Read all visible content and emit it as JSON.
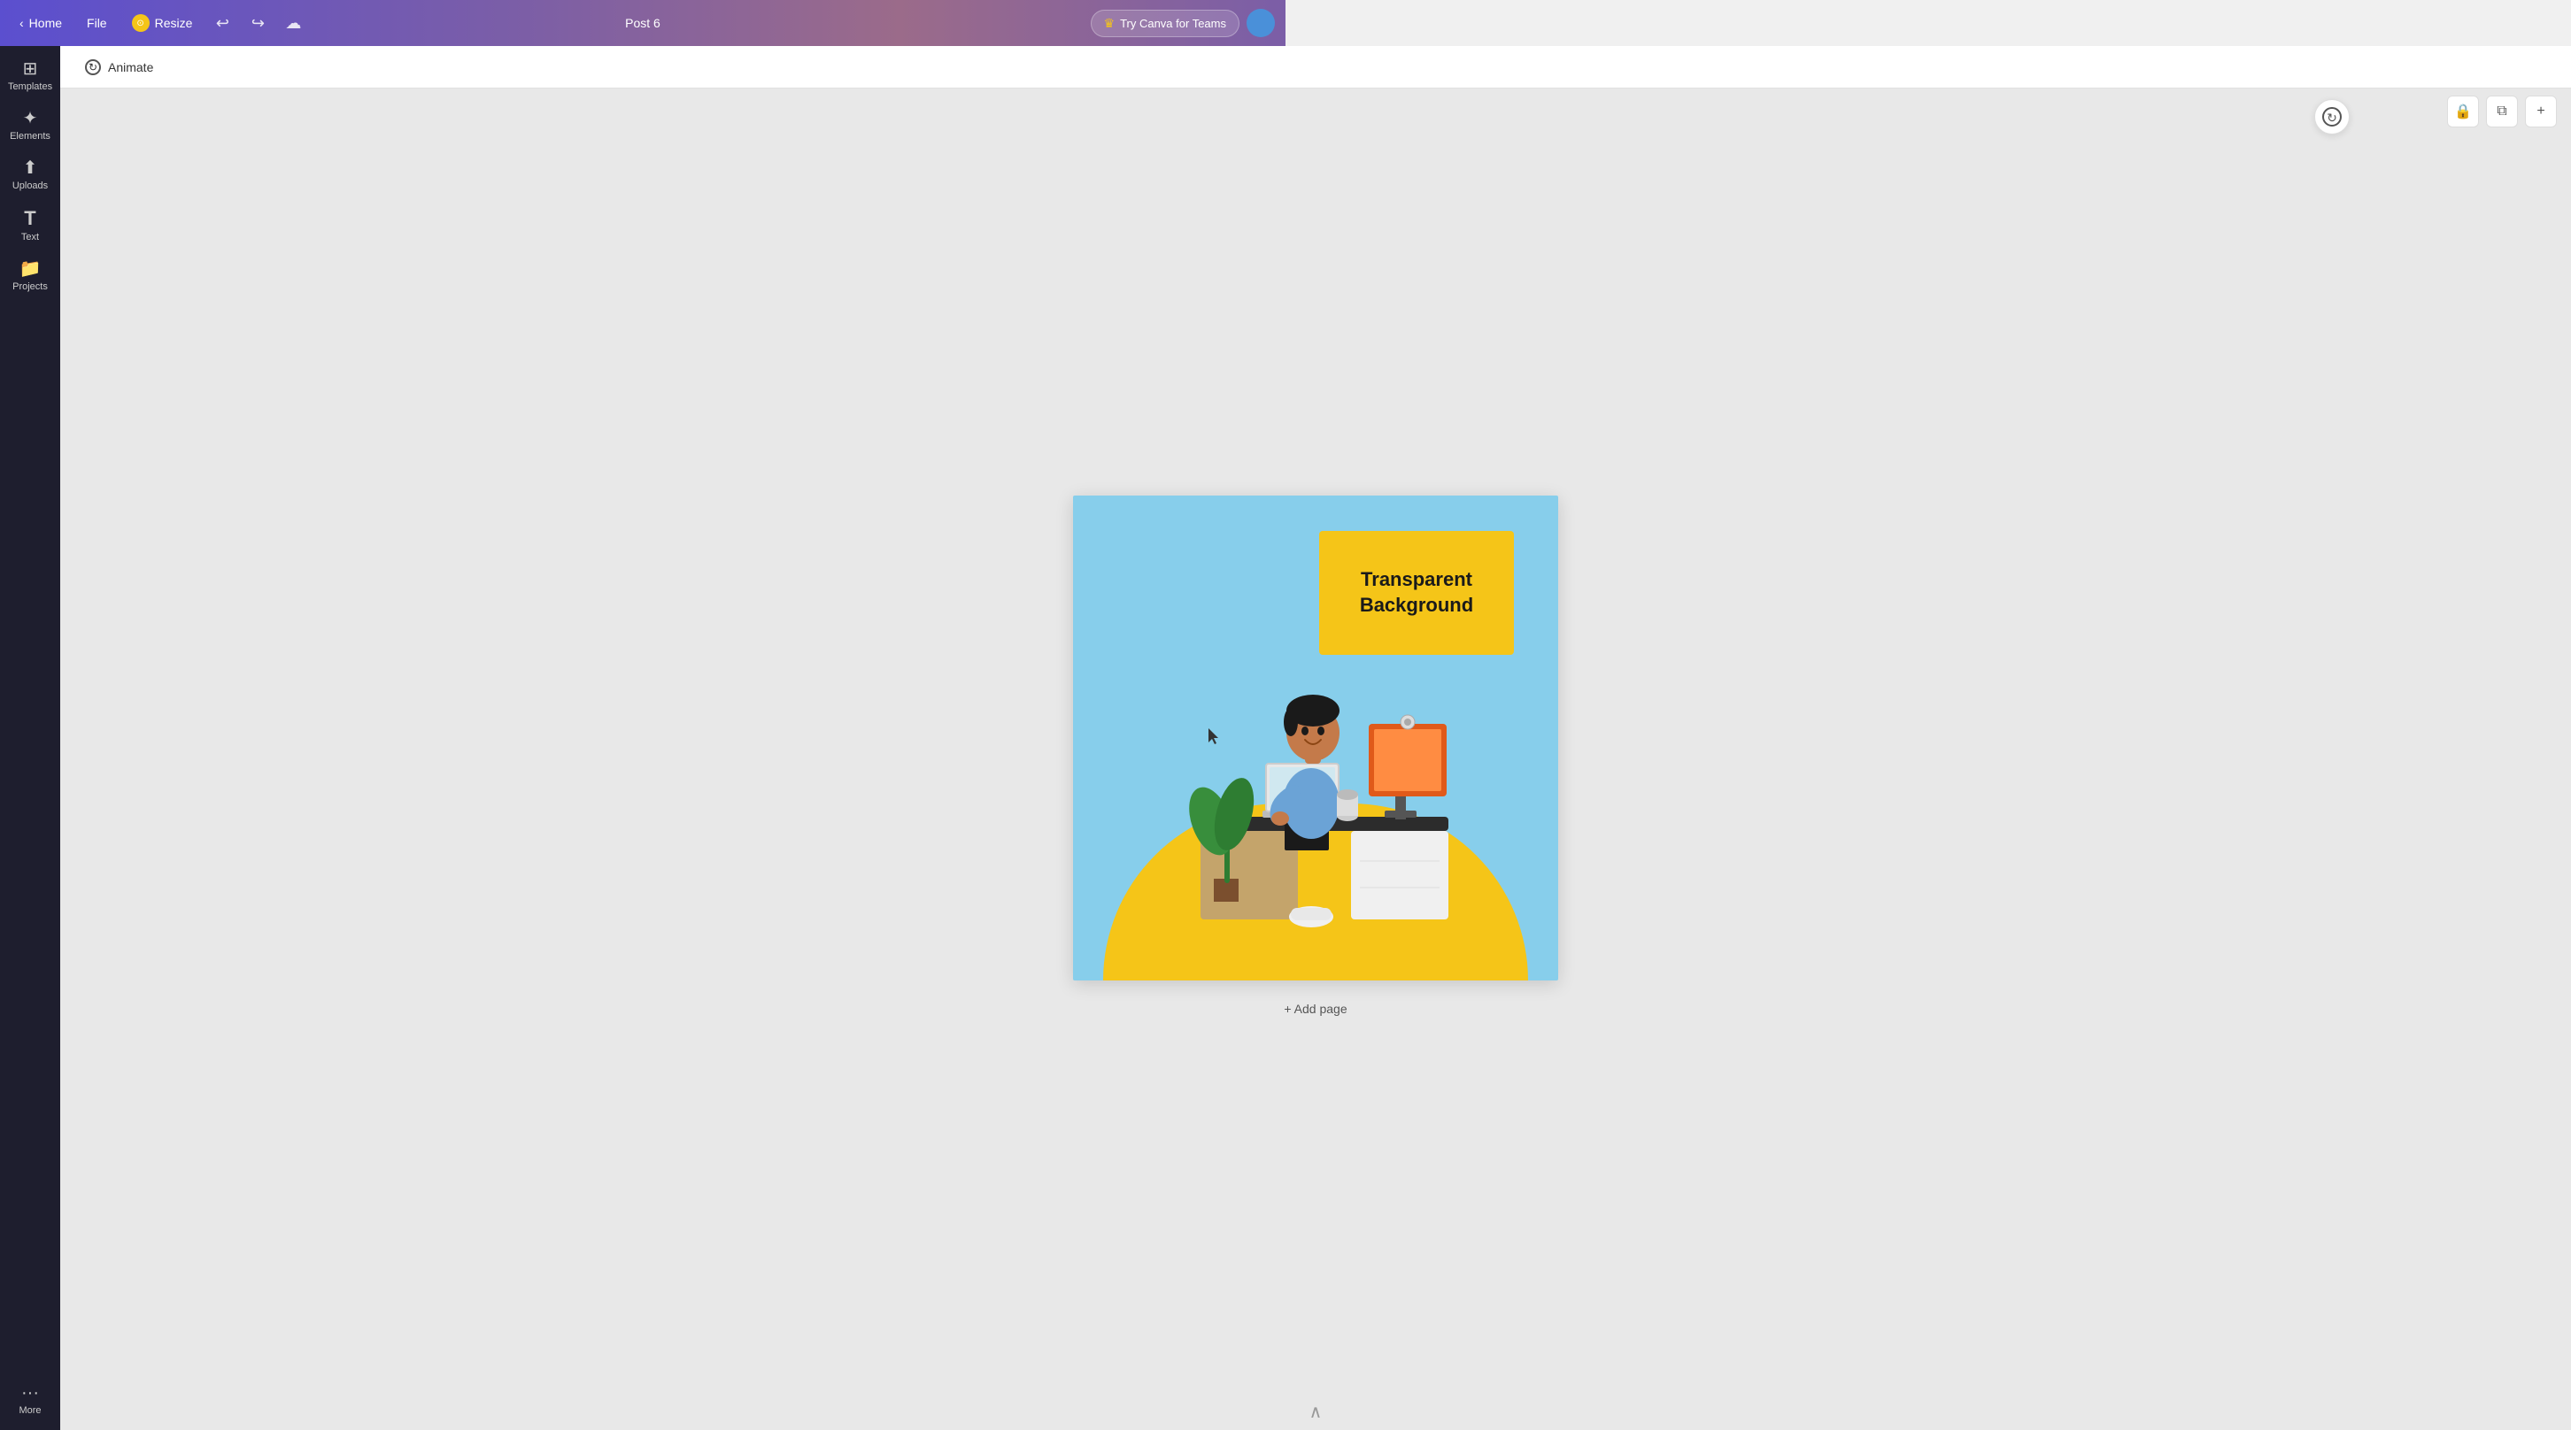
{
  "topbar": {
    "home_label": "Home",
    "file_label": "File",
    "resize_label": "Resize",
    "undo_label": "Undo",
    "redo_label": "Redo",
    "save_label": "Save to cloud",
    "doc_title": "Post 6",
    "try_canva_label": "Try Canva for Teams",
    "crown_icon": "👑"
  },
  "sidebar": {
    "items": [
      {
        "id": "templates",
        "icon": "⊞",
        "label": "Templates"
      },
      {
        "id": "elements",
        "icon": "✦",
        "label": "Elements"
      },
      {
        "id": "uploads",
        "icon": "↑",
        "label": "Uploads"
      },
      {
        "id": "text",
        "icon": "T",
        "label": "Text"
      },
      {
        "id": "projects",
        "icon": "📁",
        "label": "Projects"
      },
      {
        "id": "more",
        "icon": "•••",
        "label": "More"
      }
    ]
  },
  "animate_bar": {
    "animate_label": "Animate",
    "animate_icon": "⟳"
  },
  "canvas_toolbar": {
    "lock_icon": "🔒",
    "copy_icon": "⧉",
    "add_icon": "+"
  },
  "canvas": {
    "background_color": "#87CEEB",
    "text_box": {
      "text": "Transparent Background",
      "background": "#F5C518"
    },
    "add_page_label": "+ Add page"
  },
  "bottom_arrow": "∧"
}
